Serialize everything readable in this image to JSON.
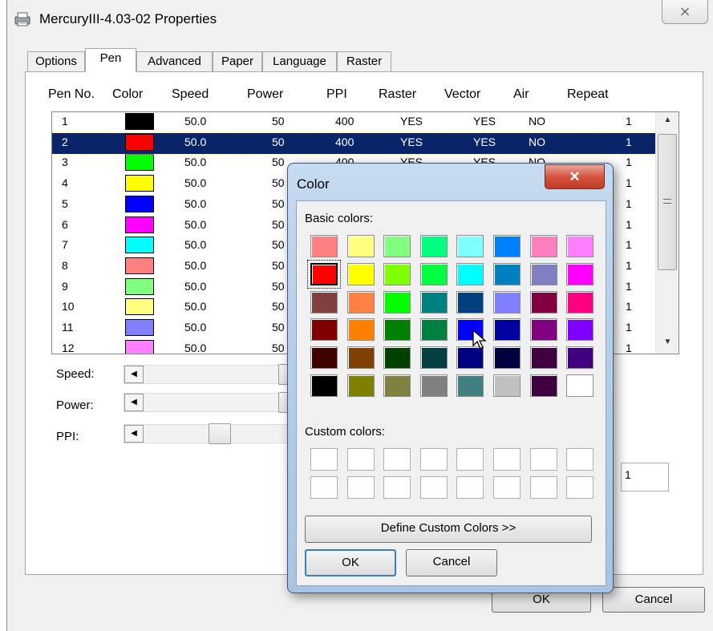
{
  "window": {
    "title": "MercuryIII-4.03-02 Properties",
    "close_glyph": "⨯"
  },
  "tabs": [
    {
      "label": "Options"
    },
    {
      "label": "Pen"
    },
    {
      "label": "Advanced"
    },
    {
      "label": "Paper"
    },
    {
      "label": "Language"
    },
    {
      "label": "Raster"
    }
  ],
  "table": {
    "headers": [
      "Pen No.",
      "Color",
      "Speed",
      "Power",
      "PPI",
      "Raster",
      "Vector",
      "Air",
      "Repeat"
    ],
    "rows": [
      {
        "pen": "1",
        "color": "#000000",
        "speed": "50.0",
        "power": "50",
        "ppi": "400",
        "raster": "YES",
        "vector": "YES",
        "air": "NO",
        "repeat": "1"
      },
      {
        "pen": "2",
        "color": "#ff0000",
        "speed": "50.0",
        "power": "50",
        "ppi": "400",
        "raster": "YES",
        "vector": "YES",
        "air": "NO",
        "repeat": "1"
      },
      {
        "pen": "3",
        "color": "#00ff00",
        "speed": "50.0",
        "power": "50",
        "ppi": "400",
        "raster": "YES",
        "vector": "YES",
        "air": "NO",
        "repeat": "1"
      },
      {
        "pen": "4",
        "color": "#ffff00",
        "speed": "50.0",
        "power": "50",
        "ppi": "",
        "raster": "",
        "vector": "",
        "air": "",
        "repeat": "1"
      },
      {
        "pen": "5",
        "color": "#0000ff",
        "speed": "50.0",
        "power": "50",
        "ppi": "",
        "raster": "",
        "vector": "",
        "air": "",
        "repeat": "1"
      },
      {
        "pen": "6",
        "color": "#ff00ff",
        "speed": "50.0",
        "power": "50",
        "ppi": "",
        "raster": "",
        "vector": "",
        "air": "",
        "repeat": "1"
      },
      {
        "pen": "7",
        "color": "#00ffff",
        "speed": "50.0",
        "power": "50",
        "ppi": "",
        "raster": "",
        "vector": "",
        "air": "",
        "repeat": "1"
      },
      {
        "pen": "8",
        "color": "#ff8080",
        "speed": "50.0",
        "power": "50",
        "ppi": "",
        "raster": "",
        "vector": "",
        "air": "",
        "repeat": "1"
      },
      {
        "pen": "9",
        "color": "#80ff80",
        "speed": "50.0",
        "power": "50",
        "ppi": "",
        "raster": "",
        "vector": "",
        "air": "",
        "repeat": "1"
      },
      {
        "pen": "10",
        "color": "#ffff80",
        "speed": "50.0",
        "power": "50",
        "ppi": "",
        "raster": "",
        "vector": "",
        "air": "",
        "repeat": "1"
      },
      {
        "pen": "11",
        "color": "#8080ff",
        "speed": "50.0",
        "power": "50",
        "ppi": "",
        "raster": "",
        "vector": "",
        "air": "",
        "repeat": "1"
      },
      {
        "pen": "12",
        "color": "#ff80ff",
        "speed": "50.0",
        "power": "50",
        "ppi": "",
        "raster": "",
        "vector": "",
        "air": "",
        "repeat": "1"
      }
    ],
    "selected_row": 1
  },
  "sliders": [
    {
      "label": "Speed:"
    },
    {
      "label": "Power:"
    },
    {
      "label": "PPI:"
    }
  ],
  "repeat_input_value": "1",
  "main_ok": "OK",
  "main_cancel": "Cancel",
  "color_dialog": {
    "title": "Color",
    "close_glyph": "✕",
    "basic_label": "Basic colors:",
    "custom_label": "Custom colors:",
    "define_label": "Define Custom Colors >>",
    "ok_label": "OK",
    "cancel_label": "Cancel",
    "selected_index": 8,
    "basic_colors": [
      "#ff8080",
      "#ffff80",
      "#80ff80",
      "#00ff80",
      "#80ffff",
      "#0080ff",
      "#ff80c0",
      "#ff80ff",
      "#ff0000",
      "#ffff00",
      "#80ff00",
      "#00ff40",
      "#00ffff",
      "#0080c0",
      "#8080c0",
      "#ff00ff",
      "#804040",
      "#ff8040",
      "#00ff00",
      "#008080",
      "#004080",
      "#8080ff",
      "#800040",
      "#ff0080",
      "#800000",
      "#ff8000",
      "#008000",
      "#008040",
      "#0000ff",
      "#0000a0",
      "#800080",
      "#8000ff",
      "#400000",
      "#804000",
      "#004000",
      "#004040",
      "#000080",
      "#000040",
      "#400040",
      "#400080",
      "#000000",
      "#808000",
      "#808040",
      "#808080",
      "#408080",
      "#c0c0c0",
      "#400040",
      "#ffffff"
    ]
  }
}
